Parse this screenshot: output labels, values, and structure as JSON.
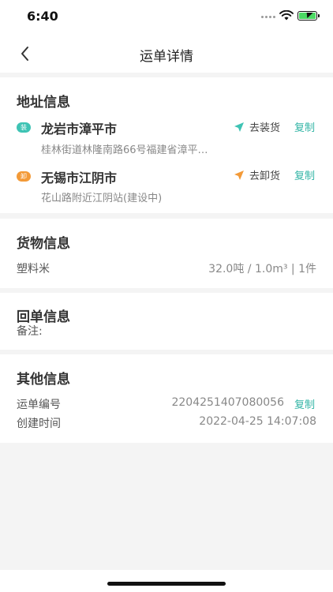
{
  "status_bar": {
    "time": "6:40"
  },
  "header": {
    "title": "运单详情"
  },
  "address_section": {
    "title": "地址信息",
    "pickup": {
      "tag": "装",
      "city": "龙岩市漳平市",
      "address": "桂林街道林隆南路66号福建省漳平…",
      "nav_label": "去装货",
      "copy_label": "复制",
      "tag_color": "#3ec3b4",
      "icon_color": "#3ec3b4"
    },
    "delivery": {
      "tag": "卸",
      "city": "无锡市江阴市",
      "address": "花山路附近江阴站(建设中)",
      "nav_label": "去卸货",
      "copy_label": "复制",
      "tag_color": "#f39a38",
      "icon_color": "#f39a38"
    }
  },
  "goods_section": {
    "title": "货物信息",
    "name": "塑料米",
    "spec": "32.0吨 / 1.0m³ | 1件"
  },
  "receipt_section": {
    "title": "回单信息",
    "remark_label": "备注:"
  },
  "other_section": {
    "title": "其他信息",
    "waybill_label": "运单编号",
    "waybill_no": "2204251407080056",
    "copy_label": "复制",
    "created_label": "创建时间",
    "created_time": "2022-04-25 14:07:08"
  },
  "colors": {
    "accent": "#33b5a6",
    "background": "#f4f4f4"
  }
}
